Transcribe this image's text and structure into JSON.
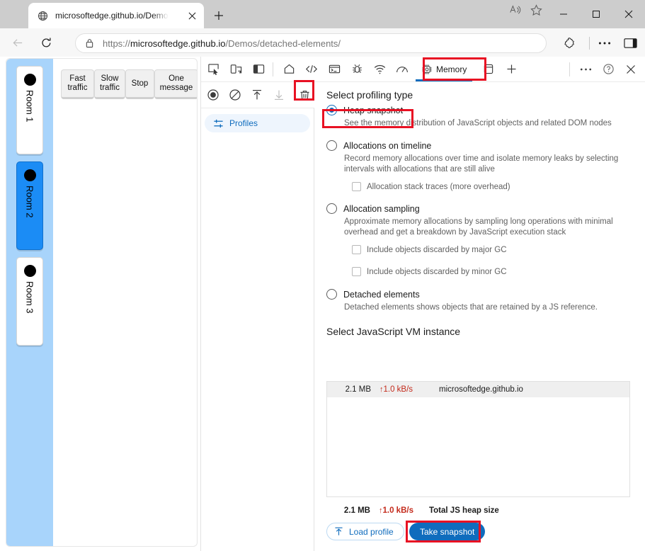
{
  "browser": {
    "tab": {
      "title": "microsoftedge.github.io/Demos/d",
      "favicon": "globe-icon",
      "close": "close-icon"
    },
    "new_tab": "+",
    "window_controls": {
      "minimize": "—",
      "maximize": "□",
      "close": "✕"
    },
    "nav": {
      "back": "back-arrow-icon",
      "reload": "reload-icon"
    },
    "address": {
      "lock": "lock-icon",
      "scheme": "https://",
      "host": "microsoftedge.github.io",
      "path": "/Demos/detached-elements/",
      "full": "https://microsoftedge.github.io/Demos/detached-elements/"
    },
    "omni_icons": {
      "read_aloud": "read-aloud-icon",
      "favorite": "star-icon"
    },
    "toolbar_right": {
      "extensions": "extensions-icon",
      "settings_more": "ellipsis-icon",
      "sidebar": "sidebar-icon"
    }
  },
  "page": {
    "buttons": [
      {
        "label": "Fast\ntraffic",
        "name": "fast-traffic-button"
      },
      {
        "label": "Slow\ntraffic",
        "name": "slow-traffic-button"
      },
      {
        "label": "Stop",
        "name": "stop-button"
      },
      {
        "label": "One\nmessage",
        "name": "one-message-button"
      }
    ],
    "rooms": [
      {
        "label": "Room 1",
        "active": false
      },
      {
        "label": "Room 2",
        "active": true
      },
      {
        "label": "Room 3",
        "active": false
      }
    ],
    "colors": {
      "rail": "#a8d4fb",
      "active_room": "#1b8cf5"
    }
  },
  "devtools": {
    "toolbar_icons": [
      "inspect-icon",
      "device-emulation-icon",
      "dock-side-icon",
      "home-icon",
      "elements-icon",
      "console-icon",
      "debugger-icon",
      "network-icon",
      "performance-icon"
    ],
    "active_tab": {
      "label": "Memory",
      "icon": "memory-chip-icon"
    },
    "after_tab_icons": [
      "application-icon",
      "add-tool-icon"
    ],
    "right_icons": [
      "ellipsis-icon",
      "help-icon",
      "close-icon"
    ],
    "panel_buttons": [
      {
        "name": "record-button",
        "icon": "record-icon",
        "enabled": true
      },
      {
        "name": "clear-button",
        "icon": "no-entry-icon",
        "enabled": true
      },
      {
        "name": "load-button",
        "icon": "upload-arrow-icon",
        "enabled": true
      },
      {
        "name": "save-button",
        "icon": "download-arrow-icon",
        "enabled": false
      },
      {
        "name": "delete-button",
        "icon": "trash-icon",
        "enabled": true,
        "highlighted": true
      }
    ],
    "sidebar": {
      "item": {
        "label": "Profiles",
        "icon": "sliders-icon"
      }
    },
    "main": {
      "profiling_title": "Select profiling type",
      "options": [
        {
          "label": "Heap snapshot",
          "selected": true,
          "highlighted": true,
          "description": "See the memory distribution of JavaScript objects and related DOM nodes",
          "checkboxes": []
        },
        {
          "label": "Allocations on timeline",
          "selected": false,
          "highlighted": false,
          "description": "Record memory allocations over time and isolate memory leaks by selecting intervals with allocations that are still alive",
          "checkboxes": [
            {
              "label": "Allocation stack traces (more overhead)",
              "checked": false
            }
          ]
        },
        {
          "label": "Allocation sampling",
          "selected": false,
          "highlighted": false,
          "description": "Approximate memory allocations by sampling long operations with minimal overhead and get a breakdown by JavaScript execution stack",
          "checkboxes": [
            {
              "label": "Include objects discarded by major GC",
              "checked": false
            },
            {
              "label": "Include objects discarded by minor GC",
              "checked": false
            }
          ]
        },
        {
          "label": "Detached elements",
          "selected": false,
          "highlighted": false,
          "description": "Detached elements shows objects that are retained by a JS reference.",
          "checkboxes": []
        }
      ],
      "vm_title": "Select JavaScript VM instance",
      "vm_rows": [
        {
          "size": "2.1 MB",
          "rate": "1.0 kB/s",
          "rate_arrow": "↑",
          "name": "microsoftedge.github.io",
          "selected": true
        }
      ],
      "totals": {
        "size": "2.1 MB",
        "rate": "1.0 kB/s",
        "rate_arrow": "↑",
        "label": "Total JS heap size"
      },
      "actions": {
        "load_profile": {
          "label": "Load profile",
          "icon": "upload-arrow-icon"
        },
        "take_snapshot": {
          "label": "Take snapshot",
          "highlighted": true
        }
      }
    }
  },
  "annotations": {
    "highlight_color": "#e81123"
  }
}
